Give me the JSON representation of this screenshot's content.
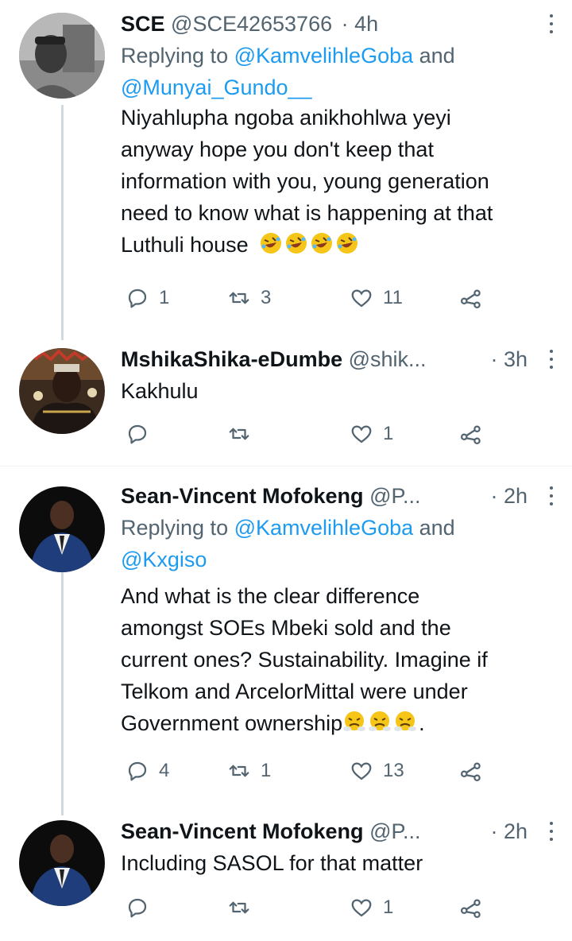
{
  "tweets": [
    {
      "name": "SCE",
      "handle": "@SCE42653766",
      "time": "· 4h",
      "replying_prefix": "Replying to ",
      "mention1": "@KamvelihleGoba",
      "mention_and": " and",
      "mention2": "@Munyai_Gundo__",
      "text_lines": [
        "Niyahlupha ngoba anikhohlwa yeyi",
        "anyway hope you don't keep that",
        "information with you, young generation",
        "need to know what is happening at that",
        "Luthuli house"
      ],
      "replies": "1",
      "retweets": "3",
      "likes": "11"
    },
    {
      "name": "MshikaShika-eDumbe",
      "handle": "@shik...",
      "time": "· 3h",
      "text": "Kakhulu",
      "replies": "",
      "retweets": "",
      "likes": "1"
    },
    {
      "name": "Sean-Vincent Mofokeng",
      "handle": "@P...",
      "time": "· 2h",
      "replying_prefix": "Replying to ",
      "mention1": "@KamvelihleGoba",
      "mention_and": " and",
      "mention2": "@Kxgiso",
      "text_lines": [
        "And what is the clear difference",
        "amongst SOEs Mbeki sold and the",
        "current ones? Sustainability. Imagine if",
        "Telkom and ArcelorMittal were under",
        "Government ownership"
      ],
      "text_tail": ".",
      "replies": "4",
      "retweets": "1",
      "likes": "13"
    },
    {
      "name": "Sean-Vincent Mofokeng",
      "handle": "@P...",
      "time": "· 2h",
      "text": "Including SASOL for that matter",
      "replies": "",
      "retweets": "",
      "likes": "1"
    }
  ],
  "icons": {
    "reply": "reply-icon",
    "retweet": "retweet-icon",
    "like": "heart-icon",
    "share": "share-icon",
    "emoji_laugh": "rolling-on-floor-laughing-emoji",
    "emoji_steam": "face-with-steam-emoji"
  },
  "colors": {
    "text": "#0f1419",
    "muted": "#536471",
    "link": "#1d9bf0",
    "line": "#cfd9de"
  }
}
